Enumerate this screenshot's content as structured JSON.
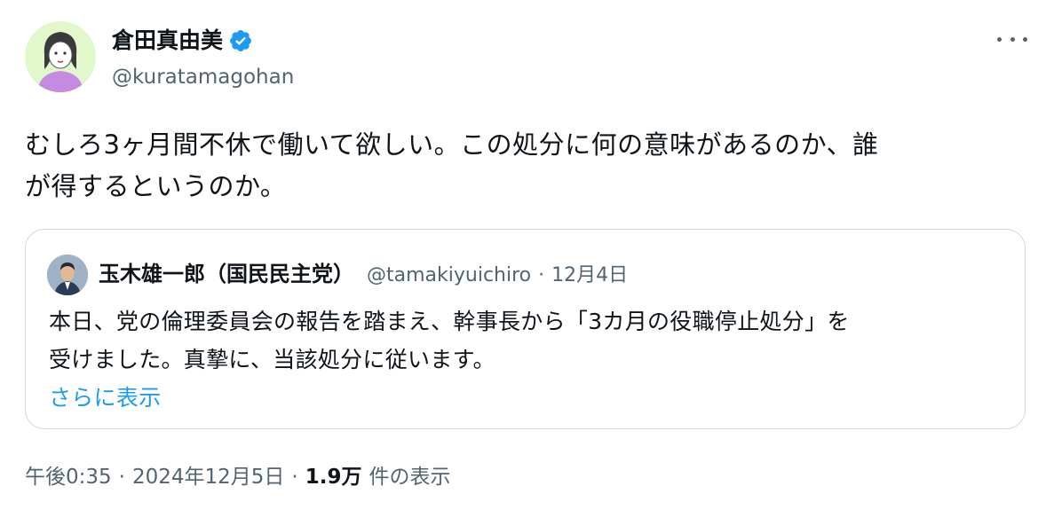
{
  "author": {
    "name": "倉田真由美",
    "handle": "@kuratamagohan",
    "verified": true,
    "verified_color": "#1d9bf0"
  },
  "tweet": {
    "line1": "むしろ3ヶ月間不休で働いて欲しい。この処分に何の意味があるのか、誰",
    "line2": "が得するというのか。"
  },
  "quote": {
    "name": "玉木雄一郎（国民民主党）",
    "handle": "@tamakiyuichiro",
    "separator": "·",
    "date": "12月4日",
    "line1": "本日、党の倫理委員会の報告を踏まえ、幹事長から「3カ月の役職停止処分」を",
    "line2": "受けました。真摯に、当該処分に従います。",
    "show_more": "さらに表示"
  },
  "meta": {
    "time": "午後0:35",
    "separator": "·",
    "date": "2024年12月5日",
    "views_count": "1.9万",
    "views_label": "件の表示"
  },
  "icons": {
    "more": "more-horizontal-icon",
    "verified": "verified-badge-icon"
  }
}
